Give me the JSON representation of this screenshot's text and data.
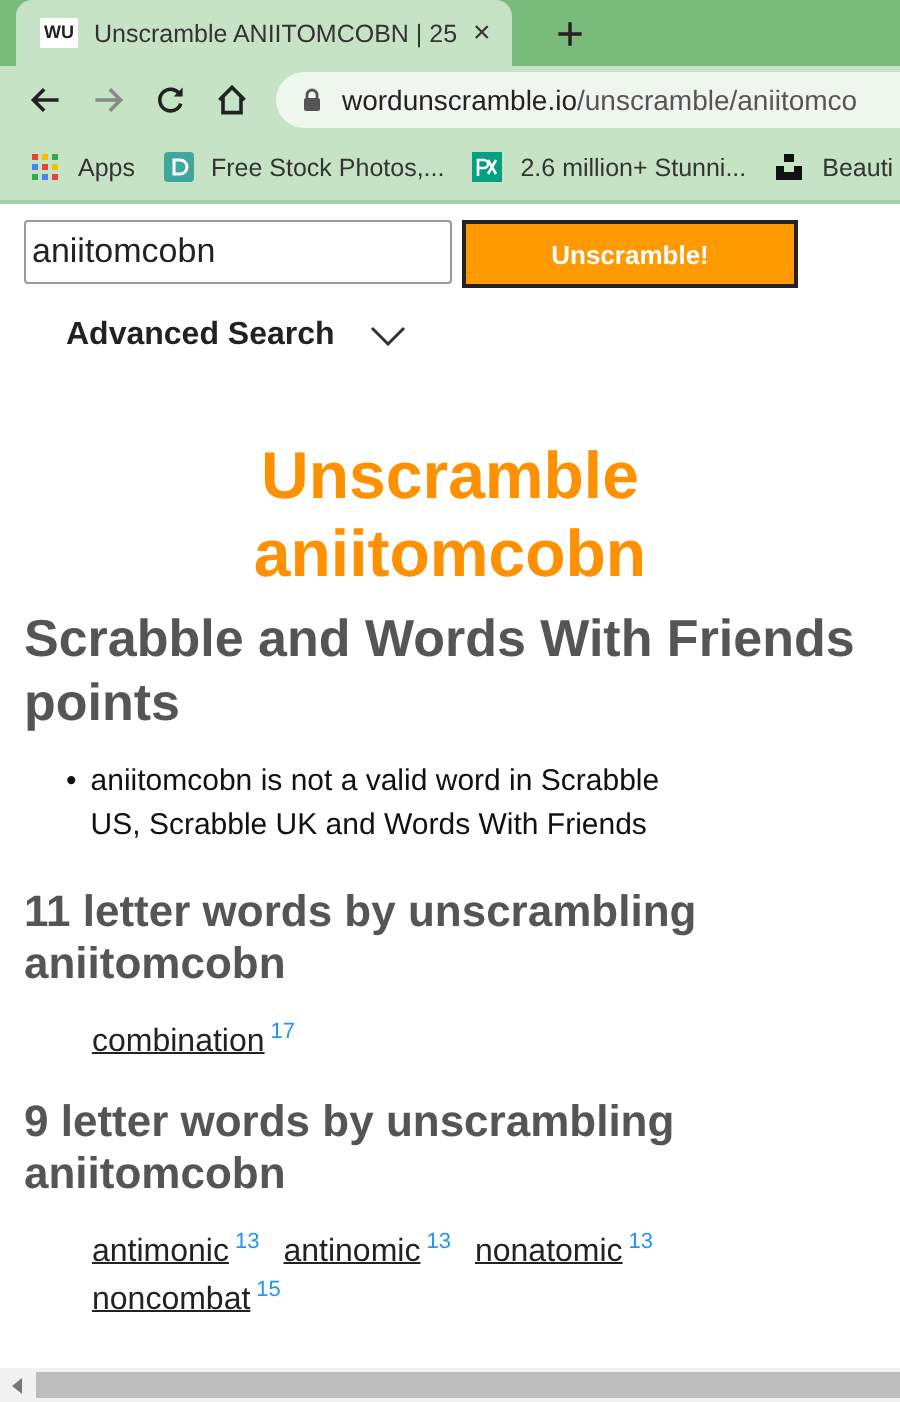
{
  "browser": {
    "tab": {
      "favicon": "WU",
      "title": "Unscramble ANIITOMCOBN | 25",
      "close": "×"
    },
    "new_tab": "+",
    "url_host": "wordunscramble.io",
    "url_path": "/unscramble/aniitomco",
    "bookmarks": [
      {
        "kind": "apps",
        "label": "Apps"
      },
      {
        "kind": "d",
        "label": "Free Stock Photos,..."
      },
      {
        "kind": "px",
        "label": "2.6 million+ Stunni..."
      },
      {
        "kind": "unsplash",
        "label": "Beauti"
      }
    ]
  },
  "search": {
    "value": "aniitomcobn",
    "button": "Unscramble!",
    "advanced": "Advanced Search"
  },
  "title_lines": [
    "Unscramble",
    "aniitomcobn"
  ],
  "points_heading": "Scrabble and Words With Friends points",
  "points_bullet": "•",
  "points_notes": [
    "aniitomcobn is not a valid word in Scrabble US, Scrabble UK and Words With Friends"
  ],
  "groups": [
    {
      "heading": "11 letter words by unscrambling aniitomcobn",
      "words": [
        {
          "word": "combination",
          "points": "17"
        }
      ]
    },
    {
      "heading": "9 letter words by unscrambling aniitomcobn",
      "words": [
        {
          "word": "antimonic",
          "points": "13"
        },
        {
          "word": "antinomic",
          "points": "13"
        },
        {
          "word": "nonatomic",
          "points": "13"
        },
        {
          "word": "noncombat",
          "points": "15"
        }
      ]
    }
  ]
}
